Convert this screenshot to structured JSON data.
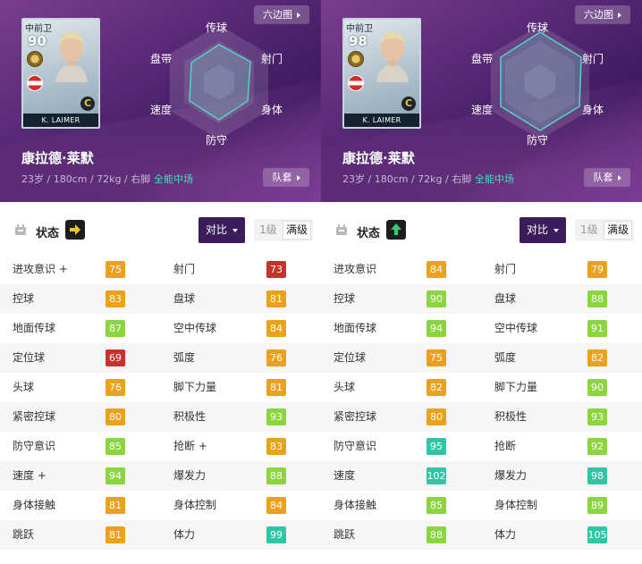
{
  "colors": {
    "red": "#c9322a",
    "orange": "#eba21a",
    "lime": "#8bd53e",
    "teal": "#2fc6a6",
    "accent_purple": "#3b1d5a",
    "role_teal": "#3fe0c0"
  },
  "panels": [
    {
      "card": {
        "position": "中前卫",
        "rating": "90",
        "name": "K. LAIMER",
        "rank": "C"
      },
      "player_name": "康拉德·莱默",
      "player_info": "23岁 / 180cm / 72kg / 右脚",
      "role": "全能中场",
      "hexagon_button": "六边图",
      "team_button": "队套",
      "radar_labels": {
        "top": "传球",
        "top_right": "射门",
        "bottom_right": "身体",
        "bottom": "防守",
        "bottom_left": "速度",
        "top_left": "盘带"
      },
      "status_label": "状态",
      "status_icon": "arrow-right-icon",
      "compare_button": "对比",
      "level_1": "1级",
      "level_max": "满级",
      "rows": [
        {
          "n1": "进攻意识 +",
          "v1": "75",
          "c1": "orange",
          "n2": "射门",
          "v2": "73",
          "c2": "red"
        },
        {
          "n1": "控球",
          "v1": "83",
          "c1": "orange",
          "n2": "盘球",
          "v2": "81",
          "c2": "orange"
        },
        {
          "n1": "地面传球",
          "v1": "87",
          "c1": "lime",
          "n2": "空中传球",
          "v2": "84",
          "c2": "orange"
        },
        {
          "n1": "定位球",
          "v1": "69",
          "c1": "red",
          "n2": "弧度",
          "v2": "76",
          "c2": "orange"
        },
        {
          "n1": "头球",
          "v1": "76",
          "c1": "orange",
          "n2": "脚下力量",
          "v2": "81",
          "c2": "orange"
        },
        {
          "n1": "紧密控球",
          "v1": "80",
          "c1": "orange",
          "n2": "积极性",
          "v2": "93",
          "c2": "lime"
        },
        {
          "n1": "防守意识",
          "v1": "85",
          "c1": "lime",
          "n2": "抢断 +",
          "v2": "83",
          "c2": "orange"
        },
        {
          "n1": "速度 +",
          "v1": "94",
          "c1": "lime",
          "n2": "爆发力",
          "v2": "88",
          "c2": "lime"
        },
        {
          "n1": "身体接触",
          "v1": "81",
          "c1": "orange",
          "n2": "身体控制",
          "v2": "84",
          "c2": "orange"
        },
        {
          "n1": "跳跃",
          "v1": "81",
          "c1": "orange",
          "n2": "体力",
          "v2": "99",
          "c2": "teal"
        }
      ]
    },
    {
      "card": {
        "position": "中前卫",
        "rating": "98",
        "name": "K. LAIMER",
        "rank": "C"
      },
      "player_name": "康拉德·莱默",
      "player_info": "23岁 / 180cm / 72kg / 右脚",
      "role": "全能中场",
      "hexagon_button": "六边图",
      "team_button": "队套",
      "radar_labels": {
        "top": "传球",
        "top_right": "射门",
        "bottom_right": "身体",
        "bottom": "防守",
        "bottom_left": "速度",
        "top_left": "盘带"
      },
      "status_label": "状态",
      "status_icon": "arrow-up-icon",
      "compare_button": "对比",
      "level_1": "1级",
      "level_max": "满级",
      "rows": [
        {
          "n1": "进攻意识",
          "v1": "84",
          "c1": "orange",
          "n2": "射门",
          "v2": "79",
          "c2": "orange"
        },
        {
          "n1": "控球",
          "v1": "90",
          "c1": "lime",
          "n2": "盘球",
          "v2": "88",
          "c2": "lime"
        },
        {
          "n1": "地面传球",
          "v1": "94",
          "c1": "lime",
          "n2": "空中传球",
          "v2": "91",
          "c2": "lime"
        },
        {
          "n1": "定位球",
          "v1": "75",
          "c1": "orange",
          "n2": "弧度",
          "v2": "82",
          "c2": "orange"
        },
        {
          "n1": "头球",
          "v1": "82",
          "c1": "orange",
          "n2": "脚下力量",
          "v2": "90",
          "c2": "lime"
        },
        {
          "n1": "紧密控球",
          "v1": "80",
          "c1": "orange",
          "n2": "积极性",
          "v2": "93",
          "c2": "lime"
        },
        {
          "n1": "防守意识",
          "v1": "95",
          "c1": "teal",
          "n2": "抢断",
          "v2": "92",
          "c2": "lime"
        },
        {
          "n1": "速度",
          "v1": "102",
          "c1": "teal",
          "n2": "爆发力",
          "v2": "98",
          "c2": "teal"
        },
        {
          "n1": "身体接触",
          "v1": "85",
          "c1": "lime",
          "n2": "身体控制",
          "v2": "89",
          "c2": "lime"
        },
        {
          "n1": "跳跃",
          "v1": "88",
          "c1": "lime",
          "n2": "体力",
          "v2": "105",
          "c2": "teal"
        }
      ]
    }
  ]
}
